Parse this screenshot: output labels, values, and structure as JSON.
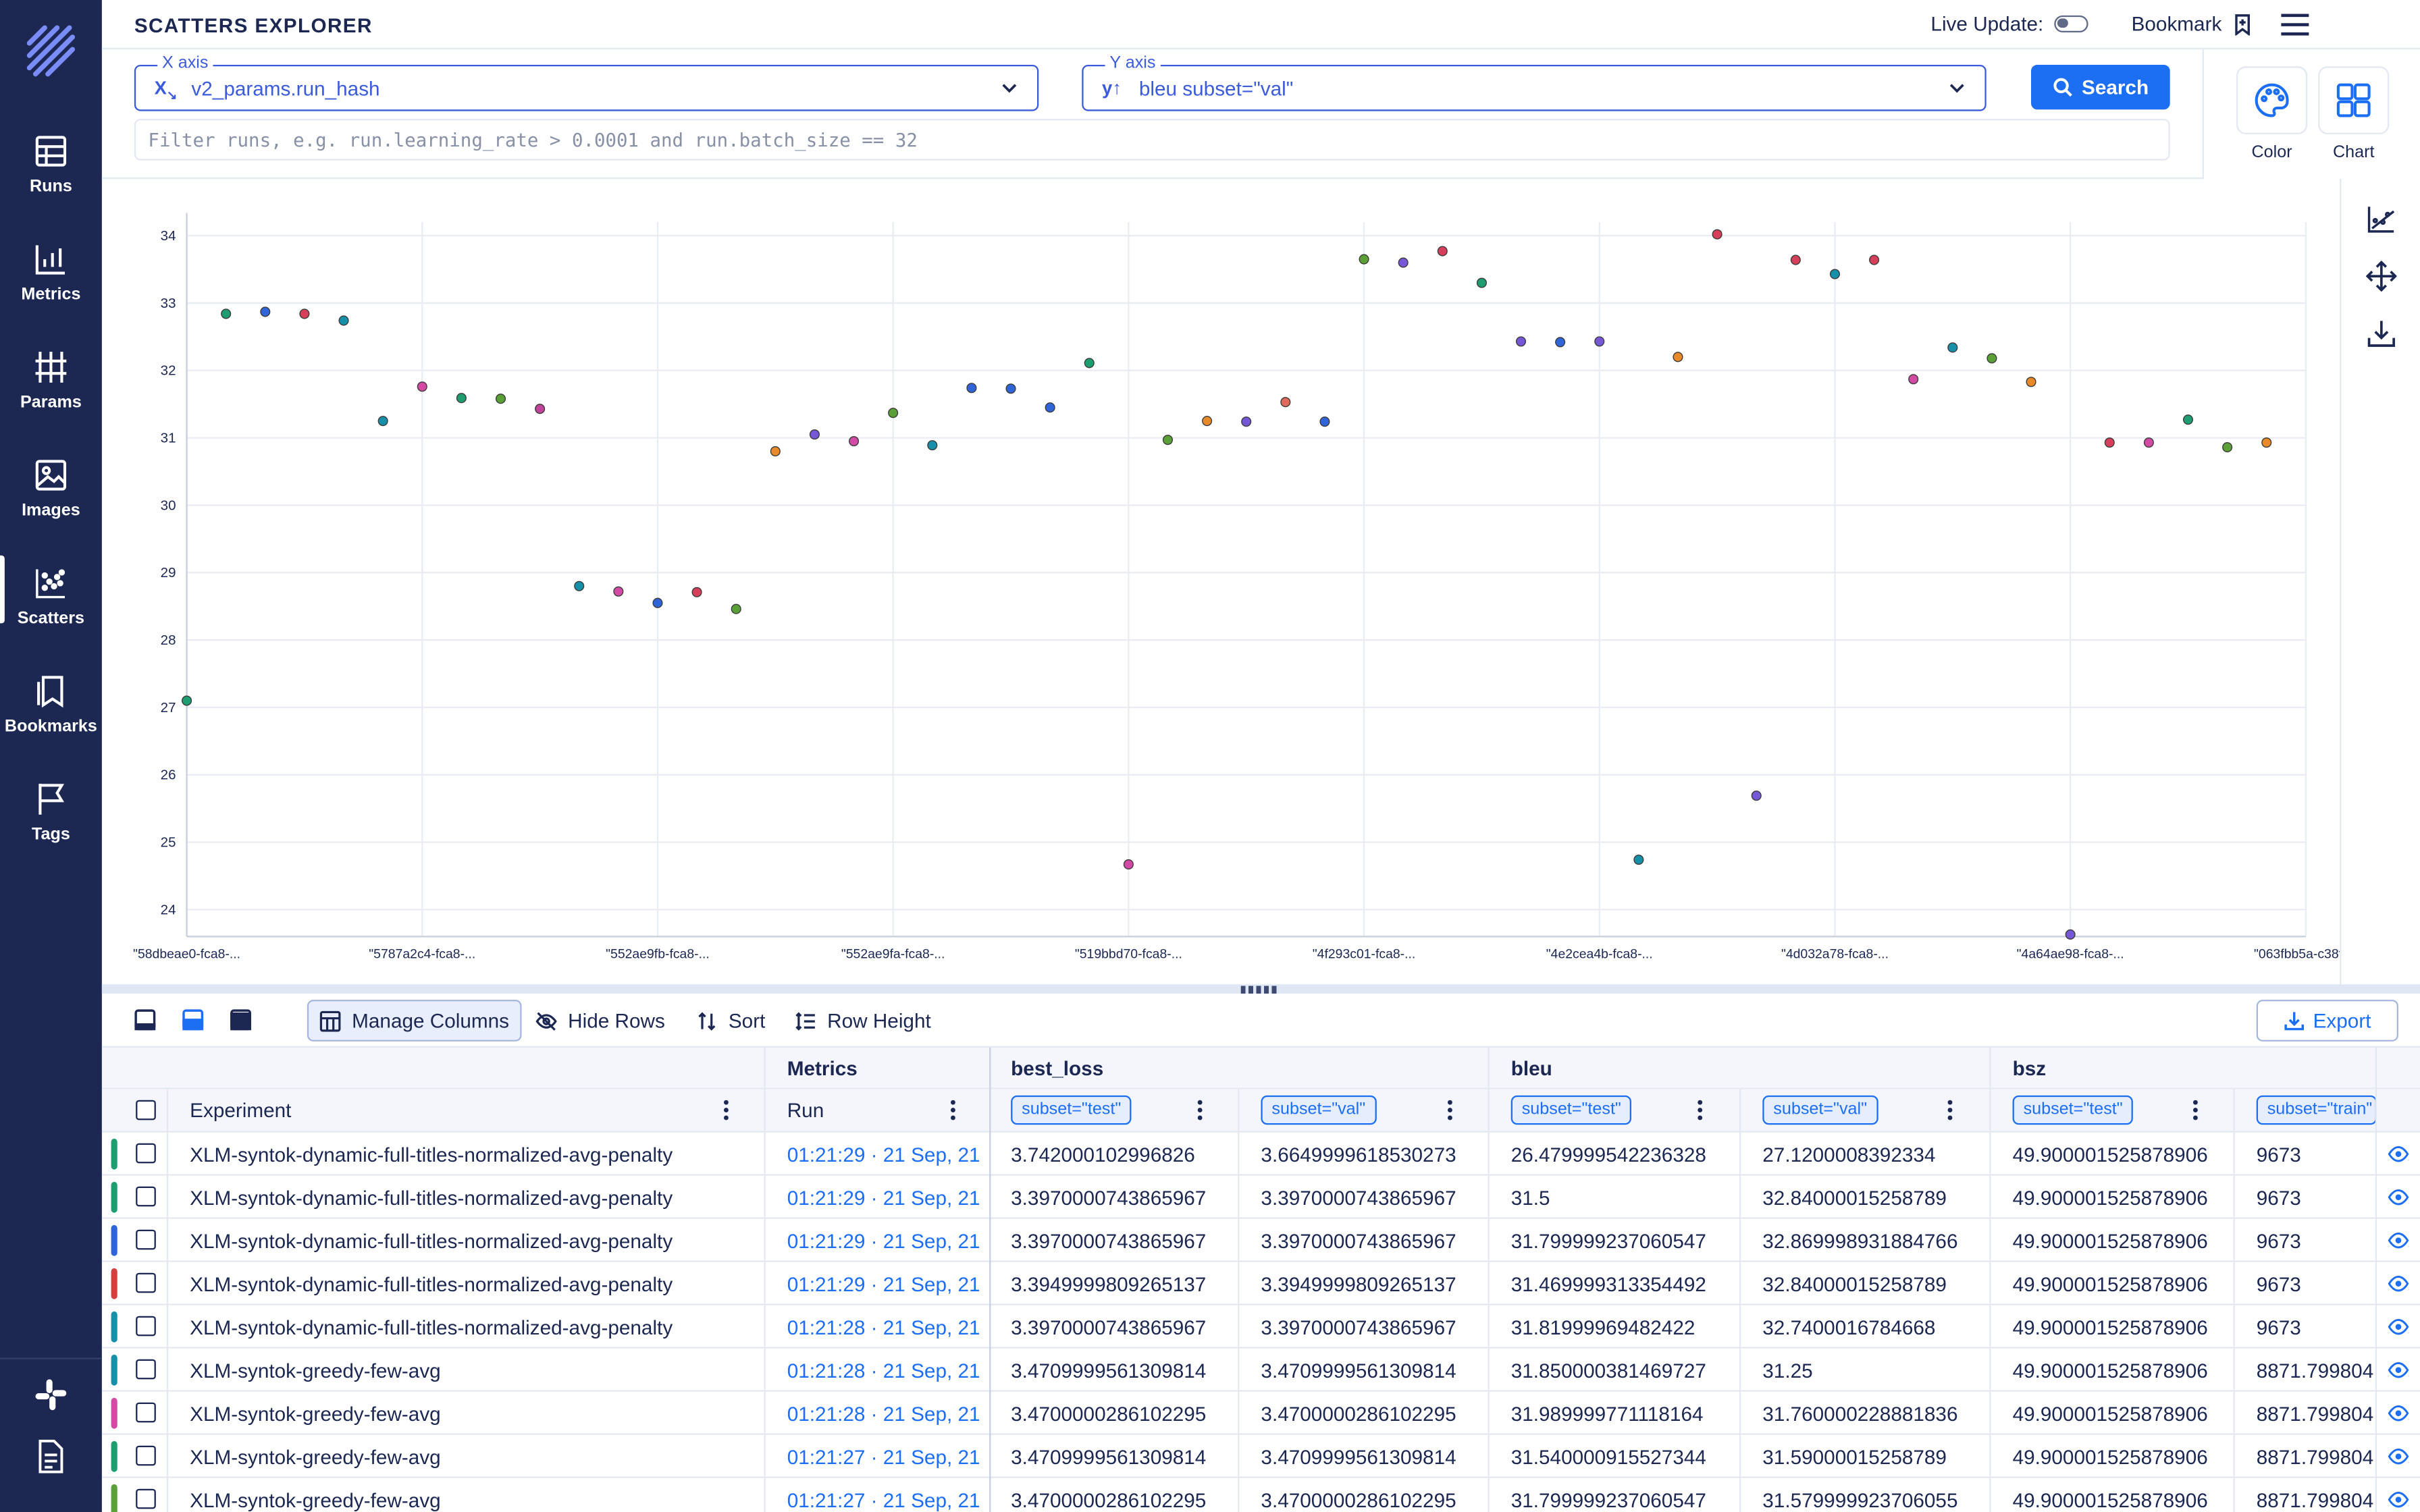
{
  "header": {
    "title": "SCATTERS EXPLORER",
    "live_update_label": "Live Update:",
    "bookmark_label": "Bookmark"
  },
  "sidebar": {
    "items": [
      {
        "label": "Runs",
        "icon": "table-icon"
      },
      {
        "label": "Metrics",
        "icon": "line-chart-icon"
      },
      {
        "label": "Params",
        "icon": "params-icon"
      },
      {
        "label": "Images",
        "icon": "image-icon"
      },
      {
        "label": "Scatters",
        "icon": "scatter-icon",
        "active": true
      },
      {
        "label": "Bookmarks",
        "icon": "bookmark-icon"
      },
      {
        "label": "Tags",
        "icon": "flag-icon"
      }
    ]
  },
  "controls": {
    "x_axis": {
      "legend": "X axis",
      "value": "v2_params.run_hash"
    },
    "y_axis": {
      "legend": "Y axis",
      "value": "bleu subset=\"val\""
    },
    "search_label": "Search",
    "filter_placeholder": "Filter runs, e.g. run.learning_rate > 0.0001 and run.batch_size == 32",
    "color_label": "Color",
    "chart_label": "Chart"
  },
  "chart_data": {
    "type": "scatter",
    "title": "",
    "xlabel": "",
    "ylabel": "",
    "ylim": [
      23.6,
      34.2
    ],
    "yticks": [
      24,
      25,
      26,
      27,
      28,
      29,
      30,
      31,
      32,
      33,
      34
    ],
    "xtick_labels": [
      "\"58dbeae0-fca8-...",
      "\"5787a2c4-fca8-...",
      "\"552ae9fb-fca8-...",
      "\"552ae9fa-fca8-...",
      "\"519bbd70-fca8-...",
      "\"4f293c01-fca8-...",
      "\"4e2cea4b-fca8-...",
      "\"4d032a78-fca8-...",
      "\"4a64ae98-fca8-...",
      "\"063fbb5a-c38f-..."
    ],
    "grid": true,
    "points": [
      {
        "x": 0,
        "y": 27.1,
        "color": "#1e9e70"
      },
      {
        "x": 1,
        "y": 32.84,
        "color": "#1e9e70"
      },
      {
        "x": 2,
        "y": 32.87,
        "color": "#3065d8"
      },
      {
        "x": 3,
        "y": 32.84,
        "color": "#d63f5a"
      },
      {
        "x": 4,
        "y": 32.74,
        "color": "#1690a8"
      },
      {
        "x": 5,
        "y": 31.25,
        "color": "#1690a8"
      },
      {
        "x": 6,
        "y": 31.76,
        "color": "#d34aa5"
      },
      {
        "x": 7,
        "y": 31.59,
        "color": "#1e9e70"
      },
      {
        "x": 8,
        "y": 31.58,
        "color": "#5aa037"
      },
      {
        "x": 9,
        "y": 31.43,
        "color": "#c0449a"
      },
      {
        "x": 10,
        "y": 28.8,
        "color": "#1690a8"
      },
      {
        "x": 11,
        "y": 28.72,
        "color": "#d34aa5"
      },
      {
        "x": 12,
        "y": 28.55,
        "color": "#3065d8"
      },
      {
        "x": 13,
        "y": 28.71,
        "color": "#d63f5a"
      },
      {
        "x": 14,
        "y": 28.46,
        "color": "#5aa037"
      },
      {
        "x": 15,
        "y": 30.8,
        "color": "#e98a2a"
      },
      {
        "x": 16,
        "y": 31.05,
        "color": "#7658d6"
      },
      {
        "x": 17,
        "y": 30.95,
        "color": "#d34aa5"
      },
      {
        "x": 18,
        "y": 31.37,
        "color": "#5aa037"
      },
      {
        "x": 19,
        "y": 30.89,
        "color": "#1690a8"
      },
      {
        "x": 20,
        "y": 31.74,
        "color": "#3065d8"
      },
      {
        "x": 21,
        "y": 31.73,
        "color": "#3065d8"
      },
      {
        "x": 22,
        "y": 31.45,
        "color": "#3065d8"
      },
      {
        "x": 23,
        "y": 32.11,
        "color": "#1e9e70"
      },
      {
        "x": 24,
        "y": 24.67,
        "color": "#d34aa5"
      },
      {
        "x": 25,
        "y": 30.97,
        "color": "#5aa037"
      },
      {
        "x": 26,
        "y": 31.25,
        "color": "#e98a2a"
      },
      {
        "x": 27,
        "y": 31.24,
        "color": "#7658d6"
      },
      {
        "x": 28,
        "y": 31.53,
        "color": "#e06a5a"
      },
      {
        "x": 29,
        "y": 31.24,
        "color": "#3065d8"
      },
      {
        "x": 30,
        "y": 33.65,
        "color": "#5aa037"
      },
      {
        "x": 31,
        "y": 33.6,
        "color": "#7658d6"
      },
      {
        "x": 32,
        "y": 33.77,
        "color": "#d63f5a"
      },
      {
        "x": 33,
        "y": 33.3,
        "color": "#1e9e70"
      },
      {
        "x": 34,
        "y": 32.43,
        "color": "#7658d6"
      },
      {
        "x": 35,
        "y": 32.42,
        "color": "#3065d8"
      },
      {
        "x": 36,
        "y": 32.43,
        "color": "#7658d6"
      },
      {
        "x": 37,
        "y": 24.74,
        "color": "#1690a8"
      },
      {
        "x": 38,
        "y": 32.2,
        "color": "#e98a2a"
      },
      {
        "x": 39,
        "y": 34.02,
        "color": "#d63f5a"
      },
      {
        "x": 40,
        "y": 25.69,
        "color": "#7658d6"
      },
      {
        "x": 41,
        "y": 33.64,
        "color": "#d63f5a"
      },
      {
        "x": 42,
        "y": 33.43,
        "color": "#1690a8"
      },
      {
        "x": 43,
        "y": 33.64,
        "color": "#d63f5a"
      },
      {
        "x": 44,
        "y": 31.87,
        "color": "#d34aa5"
      },
      {
        "x": 45,
        "y": 32.34,
        "color": "#1690a8"
      },
      {
        "x": 46,
        "y": 32.18,
        "color": "#5aa037"
      },
      {
        "x": 47,
        "y": 31.83,
        "color": "#e98a2a"
      },
      {
        "x": 48,
        "y": 23.63,
        "color": "#7658d6"
      },
      {
        "x": 49,
        "y": 30.93,
        "color": "#d63f5a"
      },
      {
        "x": 50,
        "y": 30.93,
        "color": "#d34aa5"
      },
      {
        "x": 51,
        "y": 31.27,
        "color": "#1e9e70"
      },
      {
        "x": 52,
        "y": 30.86,
        "color": "#5aa037"
      },
      {
        "x": 53,
        "y": 30.93,
        "color": "#e98a2a"
      }
    ]
  },
  "table_toolbar": {
    "manage_columns": "Manage Columns",
    "hide_rows": "Hide Rows",
    "sort": "Sort",
    "row_height": "Row Height",
    "export": "Export"
  },
  "table": {
    "groups": {
      "metrics": "Metrics",
      "best_loss": "best_loss",
      "bleu": "bleu",
      "bsz": "bsz"
    },
    "headers": {
      "experiment": "Experiment",
      "run": "Run",
      "best_loss_test": "subset=\"test\"",
      "best_loss_val": "subset=\"val\"",
      "bleu_test": "subset=\"test\"",
      "bleu_val": "subset=\"val\"",
      "bsz_test": "subset=\"test\"",
      "bsz_train": "subset=\"train\""
    },
    "rows": [
      {
        "color": "#1e9e70",
        "experiment": "XLM-syntok-dynamic-full-titles-normalized-avg-penalty",
        "run": "01:21:29 · 21 Sep, 21",
        "bl_test": "3.742000102996826",
        "bl_val": "3.6649999618530273",
        "bleu_test": "26.479999542236328",
        "bleu_val": "27.1200008392334",
        "bsz_test": "49.900001525878906",
        "bsz_train": "9673"
      },
      {
        "color": "#1e9e70",
        "experiment": "XLM-syntok-dynamic-full-titles-normalized-avg-penalty",
        "run": "01:21:29 · 21 Sep, 21",
        "bl_test": "3.3970000743865967",
        "bl_val": "3.3970000743865967",
        "bleu_test": "31.5",
        "bleu_val": "32.84000015258789",
        "bsz_test": "49.900001525878906",
        "bsz_train": "9673"
      },
      {
        "color": "#3065d8",
        "experiment": "XLM-syntok-dynamic-full-titles-normalized-avg-penalty",
        "run": "01:21:29 · 21 Sep, 21",
        "bl_test": "3.3970000743865967",
        "bl_val": "3.3970000743865967",
        "bleu_test": "31.799999237060547",
        "bleu_val": "32.869998931884766",
        "bsz_test": "49.900001525878906",
        "bsz_train": "9673"
      },
      {
        "color": "#d63f3f",
        "experiment": "XLM-syntok-dynamic-full-titles-normalized-avg-penalty",
        "run": "01:21:29 · 21 Sep, 21",
        "bl_test": "3.3949999809265137",
        "bl_val": "3.3949999809265137",
        "bleu_test": "31.469999313354492",
        "bleu_val": "32.84000015258789",
        "bsz_test": "49.900001525878906",
        "bsz_train": "9673"
      },
      {
        "color": "#1690a8",
        "experiment": "XLM-syntok-dynamic-full-titles-normalized-avg-penalty",
        "run": "01:21:28 · 21 Sep, 21",
        "bl_test": "3.3970000743865967",
        "bl_val": "3.3970000743865967",
        "bleu_test": "31.81999969482422",
        "bleu_val": "32.7400016784668",
        "bsz_test": "49.900001525878906",
        "bsz_train": "9673"
      },
      {
        "color": "#1690a8",
        "experiment": "XLM-syntok-greedy-few-avg",
        "run": "01:21:28 · 21 Sep, 21",
        "bl_test": "3.4709999561309814",
        "bl_val": "3.4709999561309814",
        "bleu_test": "31.850000381469727",
        "bleu_val": "31.25",
        "bsz_test": "49.900001525878906",
        "bsz_train": "8871.799804"
      },
      {
        "color": "#d34aa5",
        "experiment": "XLM-syntok-greedy-few-avg",
        "run": "01:21:28 · 21 Sep, 21",
        "bl_test": "3.4700000286102295",
        "bl_val": "3.4700000286102295",
        "bleu_test": "31.989999771118164",
        "bleu_val": "31.760000228881836",
        "bsz_test": "49.900001525878906",
        "bsz_train": "8871.799804"
      },
      {
        "color": "#1e9e70",
        "experiment": "XLM-syntok-greedy-few-avg",
        "run": "01:21:27 · 21 Sep, 21",
        "bl_test": "3.4709999561309814",
        "bl_val": "3.4709999561309814",
        "bleu_test": "31.540000915527344",
        "bleu_val": "31.59000015258789",
        "bsz_test": "49.900001525878906",
        "bsz_train": "8871.799804"
      },
      {
        "color": "#5aa037",
        "experiment": "XLM-syntok-greedy-few-avg",
        "run": "01:21:27 · 21 Sep, 21",
        "bl_test": "3.4700000286102295",
        "bl_val": "3.4700000286102295",
        "bleu_test": "31.799999237060547",
        "bleu_val": "31.579999923706055",
        "bsz_test": "49.900001525878906",
        "bsz_train": "8871.799804"
      }
    ]
  }
}
